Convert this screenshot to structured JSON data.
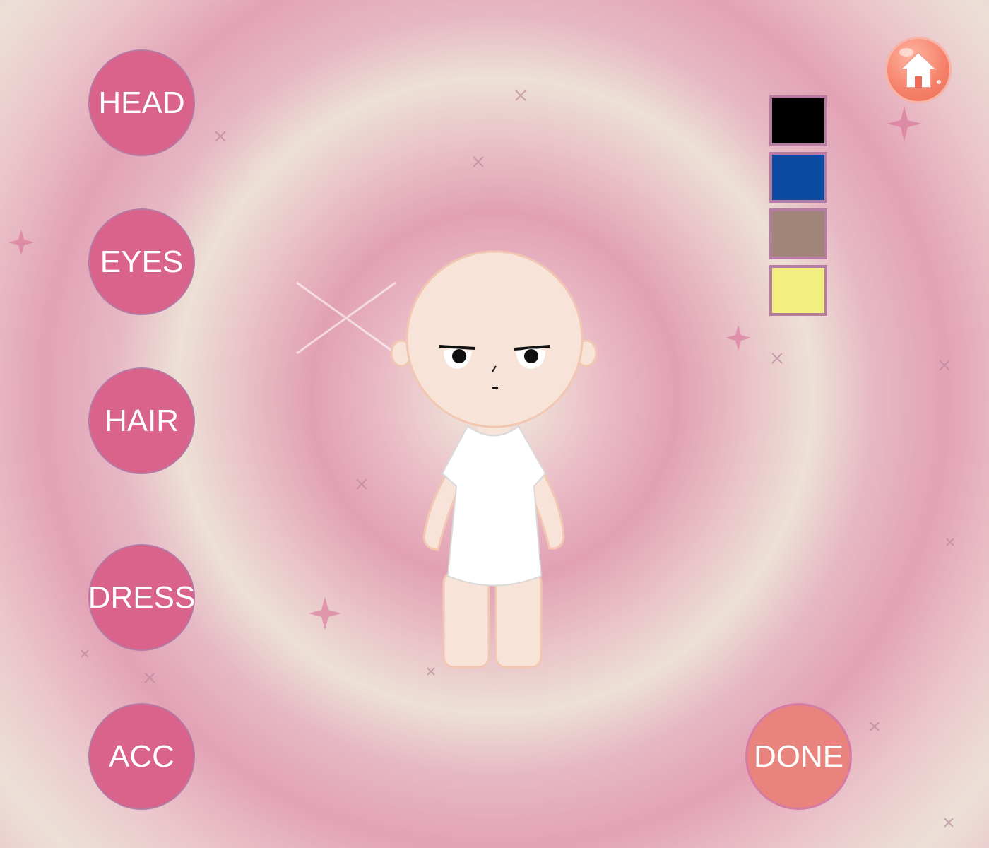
{
  "categories": [
    {
      "key": "head",
      "label": "HEAD"
    },
    {
      "key": "eyes",
      "label": "EYES"
    },
    {
      "key": "hair",
      "label": "HAIR"
    },
    {
      "key": "dress",
      "label": "DRESS"
    },
    {
      "key": "acc",
      "label": "ACC"
    }
  ],
  "done_label": "DONE",
  "home_icon": "home-icon",
  "swatches": [
    {
      "color": "#000000"
    },
    {
      "color": "#0a4aa0"
    },
    {
      "color": "#a08578"
    },
    {
      "color": "#f2ef7e"
    }
  ],
  "colors": {
    "button": "#d9638a",
    "done_button": "#e8847d",
    "skin": "#f7e3d8",
    "shirt": "#ffffff"
  }
}
